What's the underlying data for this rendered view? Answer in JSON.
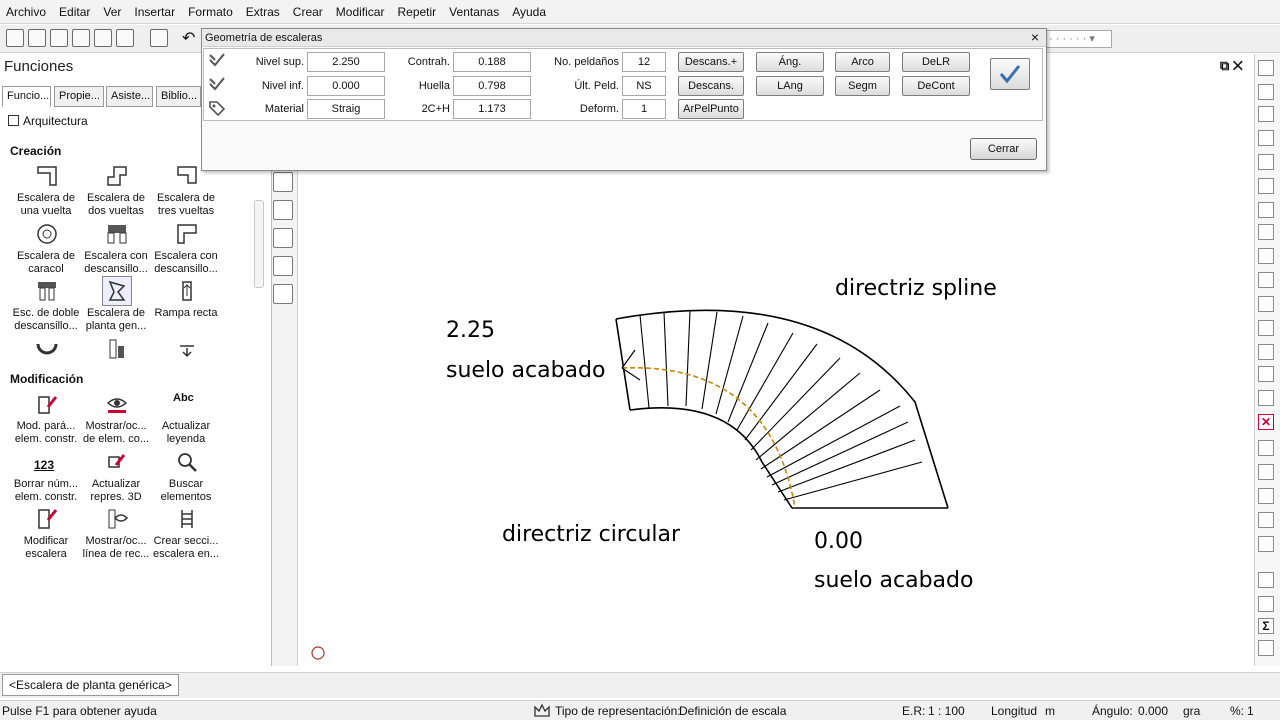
{
  "menubar": {
    "items": [
      "Archivo",
      "Editar",
      "Ver",
      "Insertar",
      "Formato",
      "Extras",
      "Crear",
      "Modificar",
      "Repetir",
      "Ventanas",
      "Ayuda"
    ]
  },
  "toolbar": {
    "combo_value": "· · · · · · ▾"
  },
  "panel": {
    "title": "Funciones",
    "tabs": [
      "Funcio...",
      "Propie...",
      "Asiste...",
      "Biblio..."
    ],
    "category": "Arquitectura",
    "section_creation": "Creación",
    "creation_items": [
      "Escalera de una vuelta",
      "Escalera de dos vueltas",
      "Escalera de tres vueltas",
      "Escalera de caracol",
      "Escalera con descansillo...",
      "Escalera con descansillo...",
      "Esc. de doble descansillo...",
      "Escalera de planta gen...",
      "Rampa recta"
    ],
    "section_mod": "Modificación",
    "mod_items": [
      "Mod. pará... elem. constr.",
      "Mostrar/oc... de elem. co...",
      "Actualizar leyenda",
      "Borrar núm... elem. constr.",
      "Actualizar repres. 3D",
      "Buscar elementos",
      "Modificar escalera",
      "Mostrar/oc... línea de rec...",
      "Crear secci... escalera en..."
    ],
    "icon_texts": {
      "abc": "Abc",
      "num": "123"
    }
  },
  "dialog": {
    "title": "Geometría de escaleras",
    "close": "×",
    "col1": [
      {
        "label": "Nivel sup.",
        "value": "2.250"
      },
      {
        "label": "Nivel inf.",
        "value": "0.000"
      },
      {
        "label": "Material",
        "value": "Straig"
      }
    ],
    "col2": [
      {
        "label": "Contrah.",
        "value": "0.188"
      },
      {
        "label": "Huella",
        "value": "0.798"
      },
      {
        "label": "2C+H",
        "value": "1.173"
      }
    ],
    "col3": [
      {
        "label": "No. peldaños",
        "value": "12"
      },
      {
        "label": "Últ. Peld.",
        "value": "NS"
      },
      {
        "label": "Deform.",
        "value": "1"
      }
    ],
    "buttons": {
      "descans_plus": "Descans.+",
      "descans": "Descans.",
      "arpelpunto": "ArPelPunto",
      "ang": "Áng.",
      "lang": "LAng",
      "arco": "Arco",
      "segm": "Segm",
      "delr": "DeLR",
      "decont": "DeCont",
      "cerrar": "Cerrar"
    }
  },
  "canvas": {
    "label_top_level": "2.25",
    "label_top_floor": "suelo acabado",
    "label_spline": "directriz spline",
    "label_circular": "directriz circular",
    "label_bottom_level": "0.00",
    "label_bottom_floor": "suelo acabado",
    "accent_color": "#c8860a"
  },
  "tabs": {
    "document": "<Escalera de planta genérica>"
  },
  "status": {
    "help": "Pulse F1 para obtener ayuda",
    "rep_label": "Tipo de representación:",
    "rep_value": "Definición de escala",
    "scale_label": "E.R:",
    "scale_value": "1 : 100",
    "length_label": "Longitud",
    "length_unit": "m",
    "angle_label": "Ángulo:",
    "angle_value": "0.000",
    "angle_unit": "gra",
    "percent_label": "%:",
    "percent_value": "1"
  }
}
